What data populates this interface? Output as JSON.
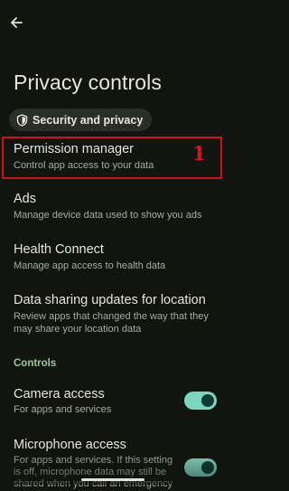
{
  "header": {
    "back_icon": "arrow-left-icon",
    "title": "Privacy controls"
  },
  "chip": {
    "icon": "shield-icon",
    "label": "Security and privacy"
  },
  "items": [
    {
      "title": "Permission manager",
      "subtitle": "Control app access to your data"
    },
    {
      "title": "Ads",
      "subtitle": "Manage device data used to show you ads"
    },
    {
      "title": "Health Connect",
      "subtitle": "Manage app access to health data"
    },
    {
      "title": "Data sharing updates for location",
      "subtitle_line1": "Review apps that changed the way that they",
      "subtitle_line2": "may share your location data"
    }
  ],
  "annotation": {
    "number": "1",
    "color": "#d00f17"
  },
  "controls": {
    "section_label": "Controls",
    "camera": {
      "title": "Camera access",
      "subtitle": "For apps and services",
      "enabled": true
    },
    "microphone": {
      "title": "Microphone access",
      "subtitle_line1": "For apps and services. If this setting",
      "subtitle_line2": "is off, microphone data may still be",
      "subtitle_line3": "shared when you call an emergency",
      "enabled": true
    }
  },
  "colors": {
    "background": "#121410",
    "accent": "#9dc79a",
    "toggle_on": "#7ed6c0"
  }
}
